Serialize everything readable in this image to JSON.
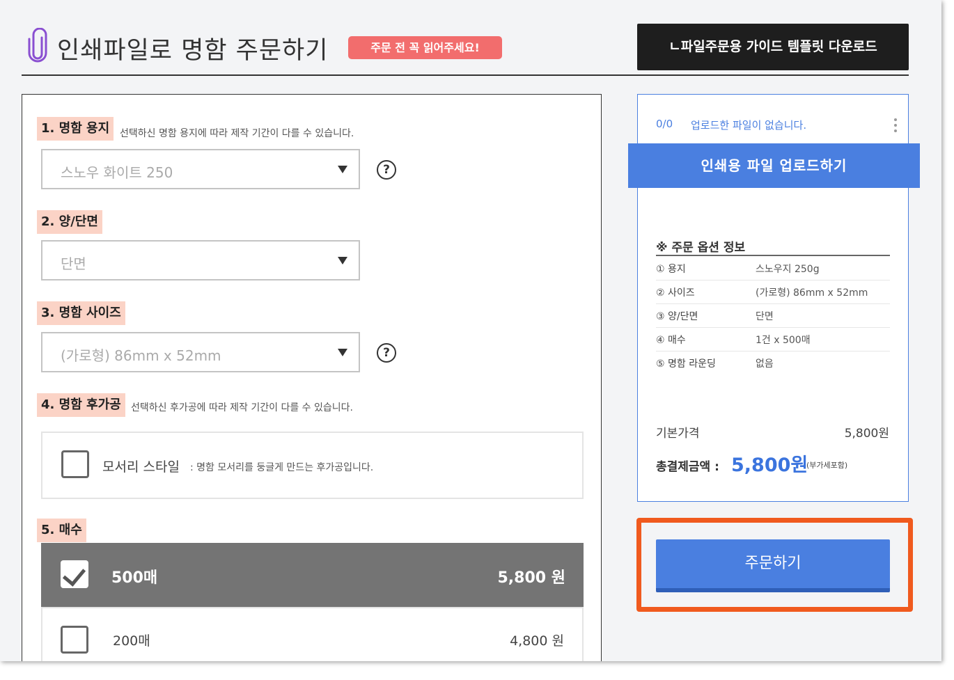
{
  "header": {
    "title": "인쇄파일로 명함 주문하기",
    "warning_badge": "주문 전 꼭 읽어주세요!",
    "guide_button": "ㄴ파일주문용 가이드 템플릿 다운로드"
  },
  "form": {
    "paper": {
      "label": "1. 명함 용지",
      "description": "선택하신 명함 용지에 따라 제작 기간이 다를 수 있습니다.",
      "selected": "스노우 화이트 250"
    },
    "sides": {
      "label": "2. 양/단면",
      "selected": "단면"
    },
    "size": {
      "label": "3. 명함 사이즈",
      "selected": "(가로형) 86mm x 52mm"
    },
    "finishing": {
      "label": "4. 명함 후가공",
      "description": "선택하신 후가공에 따라 제작 기간이 다를 수 있습니다.",
      "option_title": "모서리 스타일",
      "option_desc": ": 명함 모서리를 둥글게 만드는 후가공입니다.",
      "checked": false
    },
    "quantity": {
      "label": "5. 매수",
      "options": [
        {
          "label": "500매",
          "price": "5,800 원",
          "checked": true
        },
        {
          "label": "200매",
          "price": "4,800 원",
          "checked": false
        }
      ]
    },
    "help_glyph": "?"
  },
  "summary": {
    "file_count": "0/0",
    "no_file_text": "업로드한 파일이 없습니다.",
    "upload_button": "인쇄용 파일 업로드하기",
    "options_title": "※ 주문 옵션 정보",
    "options": [
      {
        "key": "① 용지",
        "value": "스노우지 250g"
      },
      {
        "key": "② 사이즈",
        "value": "(가로형) 86mm x 52mm"
      },
      {
        "key": "③ 양/단면",
        "value": "단면"
      },
      {
        "key": "④ 매수",
        "value": "1건 x 500매"
      },
      {
        "key": "⑤ 명함 라운딩",
        "value": "없음"
      }
    ],
    "base_price_label": "기본가격",
    "base_price": "5,800원",
    "total_label": "총결제금액 :",
    "total_price": "5,800원",
    "vat_note": "(부가세포함)"
  },
  "order_button": "주문하기",
  "colors": {
    "accent_blue": "#4a7fe0",
    "highlight_orange": "#f05a1e",
    "label_bg": "#fbd3c6",
    "warning_red": "#f26d6d"
  },
  "icons": [
    "paperclip-icon",
    "dropdown-arrow-icon",
    "help-icon",
    "checkbox-icon",
    "kebab-menu-icon"
  ]
}
